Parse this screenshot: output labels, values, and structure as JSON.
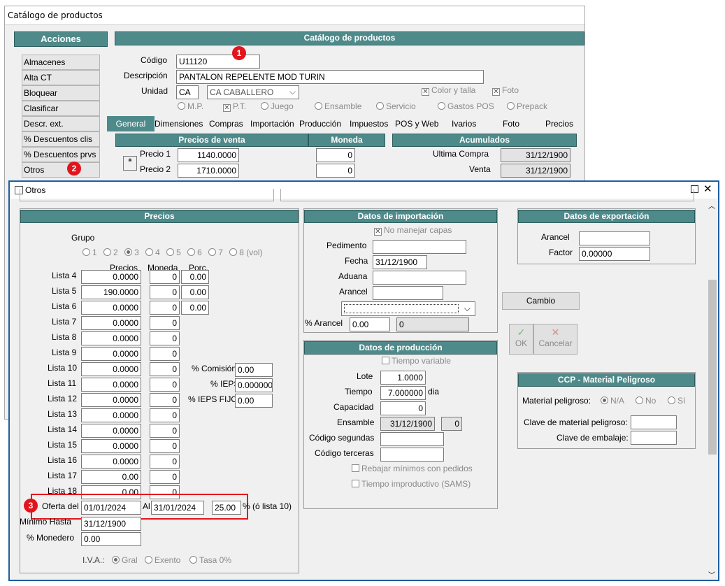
{
  "bg": {
    "title": "Catálogo de productos",
    "acciones_header": "Acciones",
    "catalog_header": "Catálogo de productos",
    "sidebar": [
      "Almacenes",
      "Alta CT",
      "Bloquear",
      "Clasificar",
      "Descr. ext.",
      "% Descuentos clis",
      "% Descuentos prvs",
      "Otros"
    ],
    "codigo_label": "Código",
    "codigo_value": "U11120",
    "descripcion_label": "Descripción",
    "descripcion_value": "PANTALON REPELENTE MOD TURIN",
    "unidad_label": "Unidad",
    "unidad_code": "CA",
    "unidad_select": "CA  CABALLERO",
    "color_talla": "Color y talla",
    "foto_chk": "Foto",
    "types": [
      "M.P.",
      "P.T.",
      "Juego",
      "Ensamble",
      "Servicio",
      "Gastos POS",
      "Prepack"
    ],
    "tabs": [
      "General",
      "Dimensiones",
      "Compras",
      "Importación",
      "Producción",
      "Impuestos",
      "POS y Web",
      "Ivarios",
      "Foto",
      "Precios"
    ],
    "precios_venta_header": "Precios de venta",
    "moneda_header": "Moneda",
    "acumulados_header": "Acumulados",
    "star": "*",
    "precio1_label": "Precio 1",
    "precio1_value": "1140.0000",
    "precio1_moneda": "0",
    "precio2_label": "Precio 2",
    "precio2_value": "1710.0000",
    "precio2_moneda": "0",
    "ultima_compra_label": "Ultima  Compra",
    "ultima_compra_value": "31/12/1900",
    "venta_label": "Venta",
    "venta_value": "31/12/1900"
  },
  "badges": [
    "1",
    "2",
    "3"
  ],
  "dialog": {
    "title": "Otros",
    "precios": {
      "header": "Precios",
      "grupo_label": "Grupo",
      "grupos": [
        "1",
        "2",
        "3",
        "4",
        "5",
        "6",
        "7",
        "8 (vol)"
      ],
      "col_precios": "Precios",
      "col_moneda": "Moneda",
      "col_porc": "Porc.",
      "rows": [
        {
          "label": "Lista 4",
          "precio": "0.0000",
          "moneda": "0",
          "porc": "0.00"
        },
        {
          "label": "Lista 5",
          "precio": "190.0000",
          "moneda": "0",
          "porc": "0.00"
        },
        {
          "label": "Lista 6",
          "precio": "0.0000",
          "moneda": "0",
          "porc": "0.00"
        },
        {
          "label": "Lista 7",
          "precio": "0.0000",
          "moneda": "0"
        },
        {
          "label": "Lista 8",
          "precio": "0.0000",
          "moneda": "0"
        },
        {
          "label": "Lista 9",
          "precio": "0.0000",
          "moneda": "0"
        },
        {
          "label": "Lista 10",
          "precio": "0.0000",
          "moneda": "0"
        },
        {
          "label": "Lista 11",
          "precio": "0.0000",
          "moneda": "0"
        },
        {
          "label": "Lista 12",
          "precio": "0.0000",
          "moneda": "0"
        },
        {
          "label": "Lista 13",
          "precio": "0.0000",
          "moneda": "0"
        },
        {
          "label": "Lista 14",
          "precio": "0.0000",
          "moneda": "0"
        },
        {
          "label": "Lista 15",
          "precio": "0.0000",
          "moneda": "0"
        },
        {
          "label": "Lista 16",
          "precio": "0.0000",
          "moneda": "0"
        },
        {
          "label": "Lista 17",
          "precio": "0.00",
          "moneda": "0"
        },
        {
          "label": "Lista 18",
          "precio": "0.00",
          "moneda": "0"
        }
      ],
      "comision_label": "% Comisión",
      "comision_value": "0.00",
      "ieps_label": "% IEPS",
      "ieps_value": "0.000000",
      "ieps_fijo_label": "%  IEPS FIJO",
      "ieps_fijo_value": "0.00",
      "oferta_label": "Oferta del",
      "oferta_from": "01/01/2024",
      "al_label": "Al",
      "oferta_to": "31/01/2024",
      "oferta_pct": "25.00",
      "oferta_suffix": "% (ó lista 10)",
      "minimo_label": "Mínimo Hasta",
      "minimo_value": "31/12/1900",
      "monedero_label": "% Monedero",
      "monedero_value": "0.00",
      "iva_label": "I.V.A.:",
      "iva_options": [
        "Gral",
        "Exento",
        "Tasa 0%"
      ]
    },
    "importacion": {
      "header": "Datos de importación",
      "no_capas": "No manejar capas",
      "pedimento_label": "Pedimento",
      "fecha_label": "Fecha",
      "fecha_value": "31/12/1900",
      "aduana_label": "Aduana",
      "arancel_label": "Arancel",
      "pct_arancel_label": "% Arancel",
      "pct_arancel_value": "0.00",
      "pct_arancel_value2": "0"
    },
    "exportacion": {
      "header": "Datos de exportación",
      "arancel_label": "Arancel",
      "factor_label": "Factor",
      "factor_value": "0.00000"
    },
    "cambio_button": "Cambio",
    "ok_label": "OK",
    "cancelar_label": "Cancelar",
    "produccion": {
      "header": "Datos de producción",
      "tiempo_variable": "Tiempo variable",
      "lote_label": "Lote",
      "lote_value": "1.0000",
      "tiempo_label": "Tiempo",
      "tiempo_value": "7.000000",
      "tiempo_unit": "dia",
      "capacidad_label": "Capacidad",
      "capacidad_value": "0",
      "ensamble_label": "Ensamble",
      "ensamble_value": "31/12/1900",
      "ensamble_value2": "0",
      "segundas_label": "Código segundas",
      "terceras_label": "Código terceras",
      "rebajar": "Rebajar mínimos con pedidos",
      "tiempo_improductivo": "Tiempo improductivo (SAMS)"
    },
    "ccp": {
      "header": "CCP - Material Peligroso",
      "material_label": "Material peligroso:",
      "options": [
        "N/A",
        "No",
        "Sí"
      ],
      "clave_label": "Clave de material peligroso:",
      "embalaje_label": "Clave de embalaje:"
    }
  }
}
